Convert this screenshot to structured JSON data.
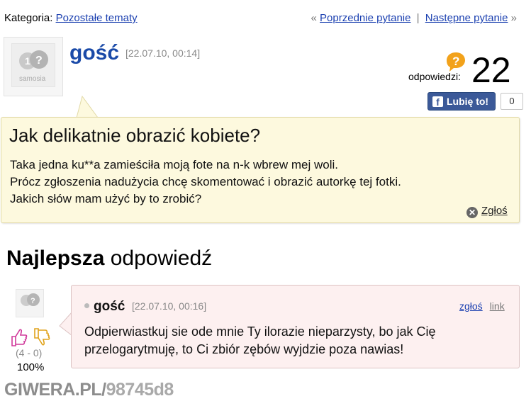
{
  "nav": {
    "category_label": "Kategoria:",
    "category_link": "Pozostałe tematy",
    "prev_marker": "«",
    "prev_link": "Poprzednie pytanie",
    "separator": "|",
    "next_link": "Następne pytanie",
    "next_marker": "»"
  },
  "question": {
    "author": "gość",
    "date": "[22.07.10, 00:14]",
    "answers_label": "odpowiedzi:",
    "answers_count": "22",
    "like_label": "Lubię to!",
    "like_count": "0",
    "title": "Jak delikatnie obrazić kobiete?",
    "body_lines": [
      "Taka jedna ku**a zamieściła moją fote na n-k wbrew mej woli.",
      "Prócz zgłoszenia nadużycia chcę skomentować i obrazić autorkę tej fotki.",
      "Jakich słów mam użyć by to zrobić?"
    ],
    "report_label": "Zgłoś"
  },
  "best_answer": {
    "heading_bold": "Najlepsza",
    "heading_rest": " odpowiedź",
    "votes": "(4 - 0)",
    "percent": "100%",
    "author": "gość",
    "date": "[22.07.10, 00:16]",
    "report_link": "zgłoś",
    "link_label": "link",
    "text_lines": [
      "Odpierwiastkuj sie ode mnie Ty ilorazie nieparzysty, bo jak Cię",
      "przelogarytmuję, to Ci zbiór zębów wyjdzie poza nawias!"
    ]
  },
  "avatar_text": "samosia",
  "watermark": {
    "part1": "GIWERA.PL/",
    "part2": "98745d8"
  },
  "colors": {
    "link": "#1a3fb0",
    "author": "#1a4aa8",
    "question_bg": "#fdf9de",
    "answer_bg": "#fdf0f0",
    "facebook": "#3b5998"
  }
}
